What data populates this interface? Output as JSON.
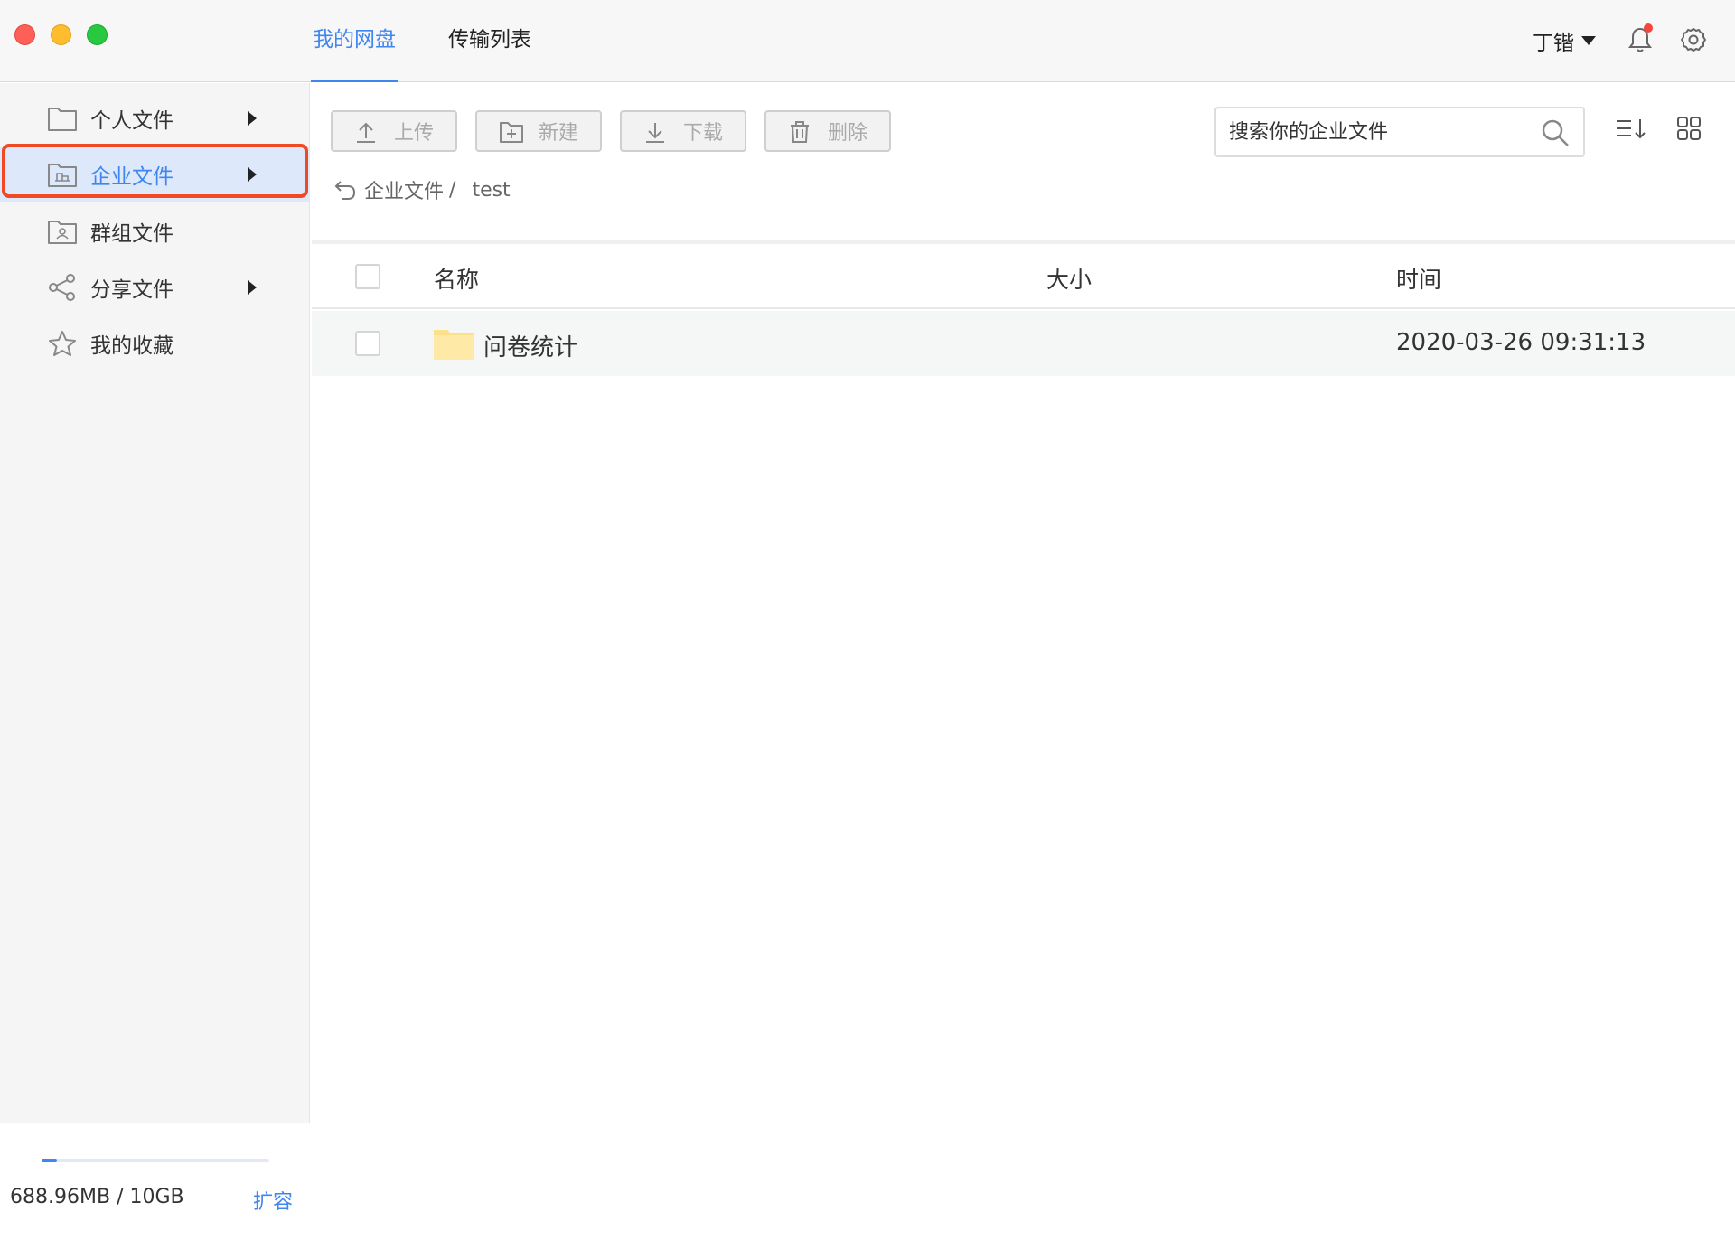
{
  "header": {
    "tabs": [
      {
        "label": "我的网盘",
        "active": true
      },
      {
        "label": "传输列表",
        "active": false
      }
    ],
    "user_name": "丁锴",
    "has_notification": true
  },
  "sidebar": {
    "items": [
      {
        "label": "个人文件",
        "icon": "folder-icon",
        "has_arrow": true
      },
      {
        "label": "企业文件",
        "icon": "enterprise-folder-icon",
        "has_arrow": true,
        "active": true
      },
      {
        "label": "群组文件",
        "icon": "group-folder-icon",
        "has_arrow": false
      },
      {
        "label": "分享文件",
        "icon": "share-icon",
        "has_arrow": true
      },
      {
        "label": "我的收藏",
        "icon": "star-icon",
        "has_arrow": false
      }
    ],
    "storage": {
      "used": "688.96MB",
      "separator": "/",
      "total": "10GB",
      "used_fraction": 0.067,
      "expand_label": "扩容"
    }
  },
  "toolbar": {
    "upload_label": "上传",
    "new_label": "新建",
    "download_label": "下载",
    "delete_label": "删除",
    "search_placeholder": "搜索你的企业文件"
  },
  "breadcrumb": {
    "parent": "企业文件",
    "separator": "/",
    "current": "test"
  },
  "table": {
    "columns": {
      "name": "名称",
      "size": "大小",
      "time": "时间"
    },
    "rows": [
      {
        "name": "问卷统计",
        "size": "",
        "time": "2020-03-26 09:31:13",
        "type": "folder"
      }
    ]
  },
  "colors": {
    "accent": "#3f86f0",
    "highlight_border": "#f04a24",
    "folder": "#fde08a"
  }
}
